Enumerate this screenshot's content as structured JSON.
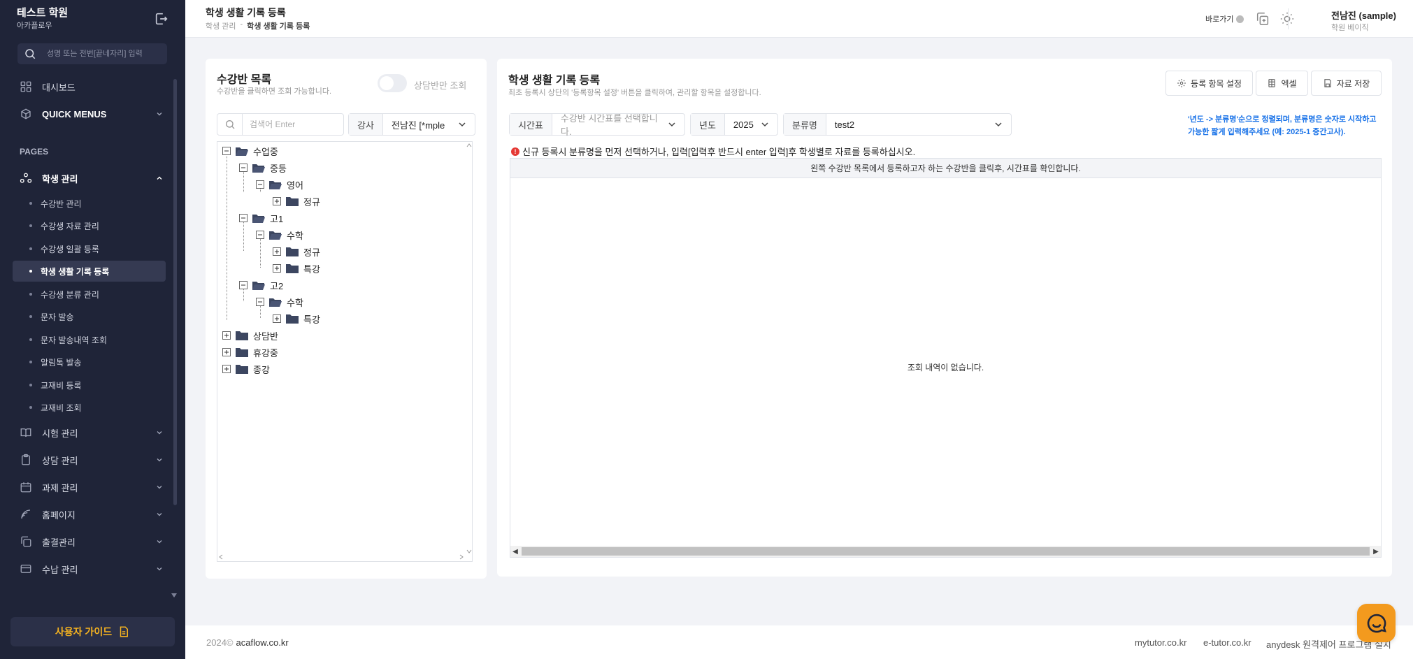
{
  "brand": {
    "name": "테스트 학원",
    "sub": "아카플로우"
  },
  "sidebar": {
    "search_placeholder": "성명 또는 전번[끝네자리] 입력",
    "dashboard": "대시보드",
    "quick_menus": "QUICK MENUS",
    "pages_label": "PAGES",
    "student_mgmt": "학생 관리",
    "sub_items": [
      "수강반 관리",
      "수강생 자료 관리",
      "수강생 일괄 등록",
      "학생 생활 기록 등록",
      "수강생 분류 관리",
      "문자 발송",
      "문자 발송내역 조회",
      "알림톡 발송",
      "교재비 등록",
      "교재비 조회"
    ],
    "sections": [
      "시험 관리",
      "상담 관리",
      "과제 관리",
      "홈페이지",
      "출결관리",
      "수납 관리"
    ],
    "guide_button": "사용자 가이드"
  },
  "header": {
    "title": "학생 생활 기록 등록",
    "breadcrumb_parent": "학생 관리",
    "breadcrumb_sep": "-",
    "breadcrumb_current": "학생 생활 기록 등록",
    "shortcut": "바로가기",
    "user_name": "전남진 (sample)",
    "user_role": "학원 베이직"
  },
  "left_panel": {
    "title": "수강반 목록",
    "subtitle": "수강반을 클릭하면 조회 가능합니다.",
    "toggle_label": "상담반만 조회",
    "search_placeholder": "검색어 Enter",
    "teacher_tag": "강사",
    "teacher_value": "전남진 [*mple",
    "tree": [
      "수업중",
      "중등",
      "영어",
      "정규",
      "고1",
      "수학",
      "정규",
      "특강",
      "고2",
      "수학",
      "특강",
      "상담반",
      "휴강중",
      "종강"
    ]
  },
  "right_panel": {
    "title": "학생 생활 기록 등록",
    "subtitle": "최초 등록시 상단의 '등록항목 설정' 버튼을 클릭하여, 관리할 항목을 설정합니다.",
    "btn_settings": "등록 항목 설정",
    "btn_excel": "엑셀",
    "btn_save": "자료 저장",
    "timetable_tag": "시간표",
    "timetable_placeholder": "수강반 시간표를 선택합니다.",
    "year_tag": "년도",
    "year_value": "2025",
    "category_tag": "분류명",
    "category_value": "test2",
    "notice": "'년도 -> 분류명'순으로 정렬되며, 분류명은 숫자로 시작하고 가능한 짧게 입력해주세요 (예: 2025-1 중간고사).",
    "warning": "신규 등록시 분류명을 먼저 선택하거나, 입력[입력후 반드시 enter 입력]후 학생별로 자료를 등록하십시오.",
    "grid_header": "왼쪽 수강반 목록에서 등록하고자 하는 수강반을 클릭후, 시간표를 확인합니다.",
    "grid_empty": "조회 내역이 없습니다."
  },
  "footer": {
    "copyright": "2024©",
    "domain": "acaflow.co.kr",
    "links": [
      "mytutor.co.kr",
      "e-tutor.co.kr",
      "anydesk 원격제어 프로그램 설치"
    ]
  },
  "colors": {
    "sidebar_bg": "#1f2438",
    "accent_orange": "#f39a1e",
    "guide_yellow": "#f5b320",
    "notice_blue": "#1a73e8",
    "warn_red": "#e53935"
  }
}
